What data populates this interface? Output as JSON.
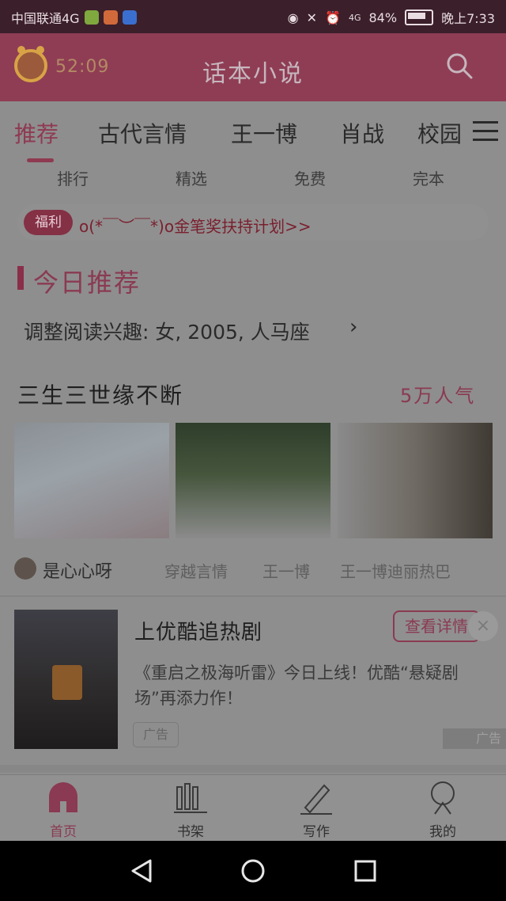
{
  "status_bar": {
    "carrier": "中国联通4G",
    "signal": "4G",
    "battery": "84%",
    "time": "晚上7:33"
  },
  "header": {
    "timer": "52:09",
    "title": "话本小说"
  },
  "tabs": {
    "items": [
      "推荐",
      "古代言情",
      "王一博",
      "肖战",
      "校园"
    ],
    "active": "推荐"
  },
  "sub_tabs": [
    "排行",
    "精选",
    "免费",
    "完本"
  ],
  "banner": {
    "badge": "福利",
    "text": "o(*￣︶￣*)o金笔奖扶持计划>>"
  },
  "today": {
    "title": "今日推荐",
    "adjust_text": "调整阅读兴趣: 女, 2005, 人马座",
    "chevron": "›"
  },
  "featured": {
    "title": "三生三世缘不断",
    "popularity": "5万人气",
    "author": "是心心呀",
    "tags": [
      "穿越言情",
      "王一博",
      "王一博迪丽热巴"
    ]
  },
  "ad": {
    "title": "上优酷追热剧",
    "button": "查看详情",
    "close": "×",
    "description": "《重启之极海听雷》今日上线！优酷“悬疑剧场”再添力作！",
    "tag": "广告",
    "mark": "广告"
  },
  "bottom_nav": [
    {
      "label": "首页",
      "icon": "home-icon",
      "active": true
    },
    {
      "label": "书架",
      "icon": "bookshelf-icon",
      "active": false
    },
    {
      "label": "写作",
      "icon": "pen-icon",
      "active": false
    },
    {
      "label": "我的",
      "icon": "profile-icon",
      "active": false
    }
  ],
  "colors": {
    "accent": "#8f3a52",
    "header_bg": "#8f3d55",
    "status_bg": "#3b1f2a"
  }
}
